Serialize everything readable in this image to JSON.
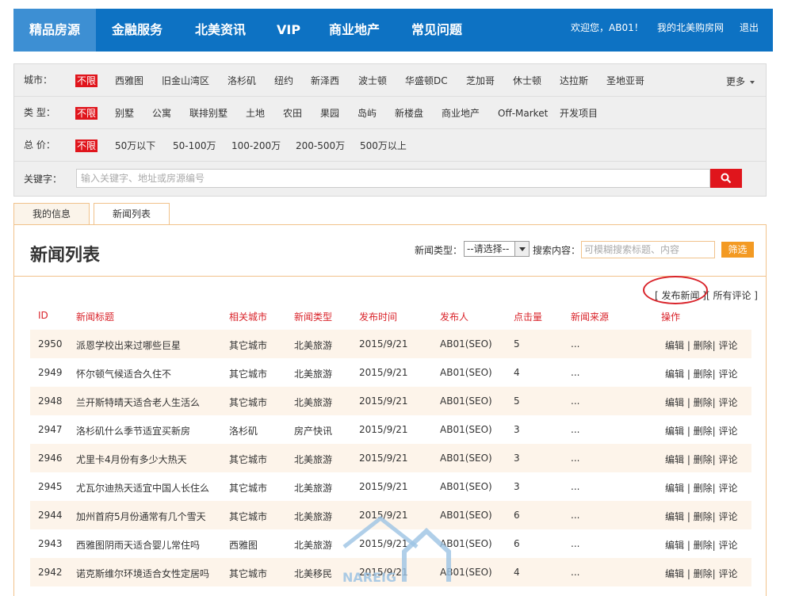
{
  "nav": {
    "items": [
      "精品房源",
      "金融服务",
      "北美资讯",
      "VIP",
      "商业地产",
      "常见问题"
    ],
    "welcome": "欢迎您，AB01！",
    "my_link": "我的北美购房网",
    "logout": "退出"
  },
  "filters": {
    "city_label": "城市：",
    "city_options": [
      "不限",
      "西雅图",
      "旧金山湾区",
      "洛杉矶",
      "纽约",
      "新泽西",
      "波士顿",
      "华盛顿DC",
      "芝加哥",
      "休士顿",
      "达拉斯",
      "圣地亚哥"
    ],
    "more": "更多",
    "type_label": "类 型：",
    "type_options": [
      "不限",
      "别墅",
      "公寓",
      "联排别墅",
      "土地",
      "农田",
      "果园",
      "岛屿",
      "新楼盘",
      "商业地产",
      "Off-Market",
      "开发项目"
    ],
    "price_label": "总 价：",
    "price_options": [
      "不限",
      "50万以下",
      "50-100万",
      "100-200万",
      "200-500万",
      "500万以上"
    ],
    "keyword_label": "关键字：",
    "keyword_placeholder": "输入关键字、地址或房源编号"
  },
  "tabs": [
    "我的信息",
    "新闻列表"
  ],
  "main": {
    "title": "新闻列表",
    "type_label": "新闻类型：",
    "type_select_value": "--请选择--",
    "search_label": "搜索内容：",
    "search_placeholder": "可模糊搜索标题、内容",
    "filter_button": "筛选",
    "links": "[ 发布新闻 ][ 所有评论 ]"
  },
  "table": {
    "headers": [
      "ID",
      "新闻标题",
      "相关城市",
      "新闻类型",
      "发布时间",
      "发布人",
      "点击量",
      "新闻来源",
      "操作"
    ],
    "rows": [
      {
        "id": "2950",
        "title": "派恩学校出来过哪些巨星",
        "city": "其它城市",
        "type": "北美旅游",
        "date": "2015/9/21",
        "author": "AB01(SEO)",
        "clicks": "5",
        "source": "...",
        "ops": "编辑 |  删除| 评论"
      },
      {
        "id": "2949",
        "title": "怀尔顿气候适合久住不",
        "city": "其它城市",
        "type": "北美旅游",
        "date": "2015/9/21",
        "author": "AB01(SEO)",
        "clicks": "4",
        "source": "...",
        "ops": "编辑 |  删除| 评论"
      },
      {
        "id": "2948",
        "title": "兰开斯特晴天适合老人生活么",
        "city": "其它城市",
        "type": "北美旅游",
        "date": "2015/9/21",
        "author": "AB01(SEO)",
        "clicks": "5",
        "source": "...",
        "ops": "编辑 |  删除| 评论"
      },
      {
        "id": "2947",
        "title": "洛杉矶什么季节适宜买新房",
        "city": "洛杉矶",
        "type": "房产快讯",
        "date": "2015/9/21",
        "author": "AB01(SEO)",
        "clicks": "3",
        "source": "...",
        "ops": "编辑 |  删除| 评论"
      },
      {
        "id": "2946",
        "title": "尤里卡4月份有多少大热天",
        "city": "其它城市",
        "type": "北美旅游",
        "date": "2015/9/21",
        "author": "AB01(SEO)",
        "clicks": "3",
        "source": "...",
        "ops": "编辑 |  删除| 评论"
      },
      {
        "id": "2945",
        "title": "尤瓦尔迪热天适宜中国人长住么",
        "city": "其它城市",
        "type": "北美旅游",
        "date": "2015/9/21",
        "author": "AB01(SEO)",
        "clicks": "3",
        "source": "...",
        "ops": "编辑 |  删除| 评论"
      },
      {
        "id": "2944",
        "title": "加州首府5月份通常有几个雪天",
        "city": "其它城市",
        "type": "北美旅游",
        "date": "2015/9/21",
        "author": "AB01(SEO)",
        "clicks": "6",
        "source": "...",
        "ops": "编辑 |  删除| 评论"
      },
      {
        "id": "2943",
        "title": "西雅图阴雨天适合婴儿常住吗",
        "city": "西雅图",
        "type": "北美旅游",
        "date": "2015/9/21",
        "author": "AB01(SEO)",
        "clicks": "6",
        "source": "...",
        "ops": "编辑 |  删除| 评论"
      },
      {
        "id": "2942",
        "title": "诺克斯维尔环境适合女性定居吗",
        "city": "其它城市",
        "type": "北美移民",
        "date": "2015/9/21",
        "author": "AB01(SEO)",
        "clicks": "4",
        "source": "...",
        "ops": "编辑 |  删除| 评论"
      }
    ]
  },
  "watermark": "NAREIG"
}
